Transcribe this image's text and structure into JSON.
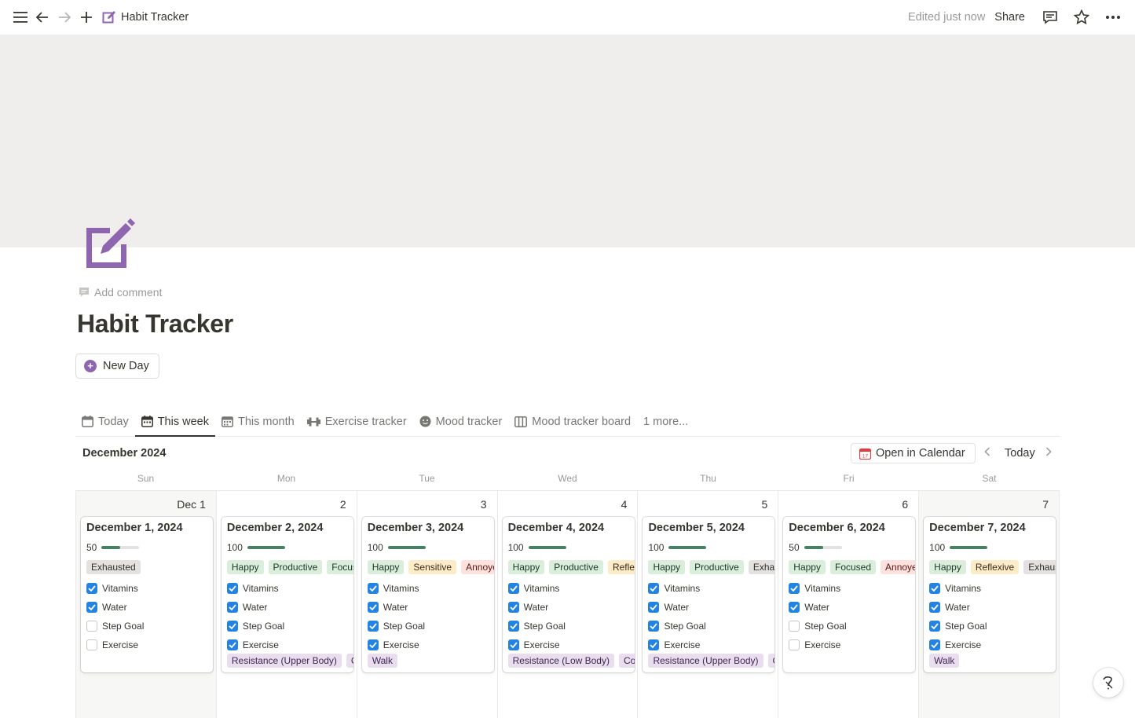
{
  "topbar": {
    "page_title": "Habit Tracker",
    "edited": "Edited just now",
    "share": "Share"
  },
  "page": {
    "add_comment": "Add comment",
    "title": "Habit Tracker",
    "new_day": "New Day"
  },
  "tabs": [
    {
      "label": "Today",
      "icon": "calendar-icon",
      "active": false
    },
    {
      "label": "This week",
      "icon": "calendar-icon",
      "active": true
    },
    {
      "label": "This month",
      "icon": "calendar-grid-icon",
      "active": false
    },
    {
      "label": "Exercise tracker",
      "icon": "dumbbell-icon",
      "active": false
    },
    {
      "label": "Mood tracker",
      "icon": "smiley-icon",
      "active": false
    },
    {
      "label": "Mood tracker board",
      "icon": "board-icon",
      "active": false
    },
    {
      "label": "1 more...",
      "icon": "",
      "active": false
    }
  ],
  "calendar": {
    "month_label": "December 2024",
    "open_in_calendar": "Open in Calendar",
    "today_label": "Today",
    "weekdays": [
      "Sun",
      "Mon",
      "Tue",
      "Wed",
      "Thu",
      "Fri",
      "Sat"
    ],
    "days": [
      {
        "num": "Dec 1",
        "title": "December 1, 2024",
        "score": "50",
        "progress": 0.5,
        "tags": [
          {
            "t": "Exhausted",
            "bg": "#e3e2e0",
            "fg": "#32302c"
          }
        ],
        "checks": [
          {
            "l": "Vitamins",
            "c": true
          },
          {
            "l": "Water",
            "c": true
          },
          {
            "l": "Step Goal",
            "c": false
          },
          {
            "l": "Exercise",
            "c": false
          }
        ],
        "exercise": []
      },
      {
        "num": "2",
        "title": "December 2, 2024",
        "score": "100",
        "progress": 1.0,
        "tags": [
          {
            "t": "Happy",
            "bg": "#dbeddb",
            "fg": "#1c3829"
          },
          {
            "t": "Productive",
            "bg": "#dbeddb",
            "fg": "#1c3829"
          },
          {
            "t": "Focus",
            "bg": "#dbeddb",
            "fg": "#1c3829"
          }
        ],
        "checks": [
          {
            "l": "Vitamins",
            "c": true
          },
          {
            "l": "Water",
            "c": true
          },
          {
            "l": "Step Goal",
            "c": true
          },
          {
            "l": "Exercise",
            "c": true
          }
        ],
        "exercise": [
          "Resistance (Upper Body)",
          "C"
        ]
      },
      {
        "num": "3",
        "title": "December 3, 2024",
        "score": "100",
        "progress": 1.0,
        "tags": [
          {
            "t": "Happy",
            "bg": "#dbeddb",
            "fg": "#1c3829"
          },
          {
            "t": "Sensitive",
            "bg": "#fdecc8",
            "fg": "#402c1b"
          },
          {
            "t": "Annoye",
            "bg": "#ffe2dd",
            "fg": "#5d1715"
          }
        ],
        "checks": [
          {
            "l": "Vitamins",
            "c": true
          },
          {
            "l": "Water",
            "c": true
          },
          {
            "l": "Step Goal",
            "c": true
          },
          {
            "l": "Exercise",
            "c": true
          }
        ],
        "exercise": [
          "Walk"
        ]
      },
      {
        "num": "4",
        "title": "December 4, 2024",
        "score": "100",
        "progress": 1.0,
        "tags": [
          {
            "t": "Happy",
            "bg": "#dbeddb",
            "fg": "#1c3829"
          },
          {
            "t": "Productive",
            "bg": "#dbeddb",
            "fg": "#1c3829"
          },
          {
            "t": "Reflex",
            "bg": "#fdecc8",
            "fg": "#402c1b"
          }
        ],
        "checks": [
          {
            "l": "Vitamins",
            "c": true
          },
          {
            "l": "Water",
            "c": true
          },
          {
            "l": "Step Goal",
            "c": true
          },
          {
            "l": "Exercise",
            "c": true
          }
        ],
        "exercise": [
          "Resistance (Low Body)",
          "Cor"
        ]
      },
      {
        "num": "5",
        "title": "December 5, 2024",
        "score": "100",
        "progress": 1.0,
        "tags": [
          {
            "t": "Happy",
            "bg": "#dbeddb",
            "fg": "#1c3829"
          },
          {
            "t": "Productive",
            "bg": "#dbeddb",
            "fg": "#1c3829"
          },
          {
            "t": "Exhau",
            "bg": "#e3e2e0",
            "fg": "#32302c"
          }
        ],
        "checks": [
          {
            "l": "Vitamins",
            "c": true
          },
          {
            "l": "Water",
            "c": true
          },
          {
            "l": "Step Goal",
            "c": true
          },
          {
            "l": "Exercise",
            "c": true
          }
        ],
        "exercise": [
          "Resistance (Upper Body)",
          "C"
        ]
      },
      {
        "num": "6",
        "title": "December 6, 2024",
        "score": "50",
        "progress": 0.5,
        "tags": [
          {
            "t": "Happy",
            "bg": "#dbeddb",
            "fg": "#1c3829"
          },
          {
            "t": "Focused",
            "bg": "#dbeddb",
            "fg": "#1c3829"
          },
          {
            "t": "Annoyed",
            "bg": "#ffe2dd",
            "fg": "#5d1715"
          }
        ],
        "checks": [
          {
            "l": "Vitamins",
            "c": true
          },
          {
            "l": "Water",
            "c": true
          },
          {
            "l": "Step Goal",
            "c": false
          },
          {
            "l": "Exercise",
            "c": false
          }
        ],
        "exercise": []
      },
      {
        "num": "7",
        "title": "December 7, 2024",
        "score": "100",
        "progress": 1.0,
        "tags": [
          {
            "t": "Happy",
            "bg": "#dbeddb",
            "fg": "#1c3829"
          },
          {
            "t": "Reflexive",
            "bg": "#fdecc8",
            "fg": "#402c1b"
          },
          {
            "t": "Exhaust",
            "bg": "#e3e2e0",
            "fg": "#32302c"
          }
        ],
        "checks": [
          {
            "l": "Vitamins",
            "c": true
          },
          {
            "l": "Water",
            "c": true
          },
          {
            "l": "Step Goal",
            "c": true
          },
          {
            "l": "Exercise",
            "c": true
          }
        ],
        "exercise": [
          "Walk"
        ]
      }
    ]
  },
  "colors": {
    "accent_purple": "#9065b0",
    "checkbox_blue": "#2383e2",
    "progress_green": "#448361"
  }
}
